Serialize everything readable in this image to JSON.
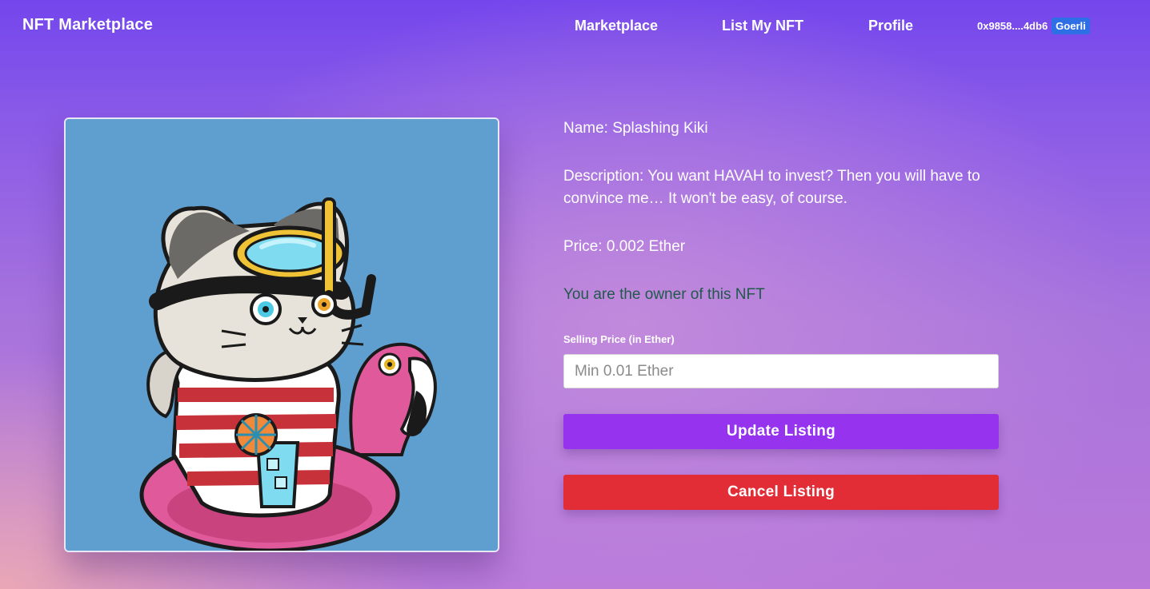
{
  "nav": {
    "brand": "NFT Marketplace",
    "links": [
      "Marketplace",
      "List My NFT",
      "Profile"
    ],
    "wallet_address": "0x9858....4db6",
    "network": "Goerli"
  },
  "nft": {
    "image_icon": "cat-snorkel-flamingo-artwork",
    "name_line": "Name: Splashing Kiki",
    "description_line": "Description: You want HAVAH to invest? Then you will have to convince me… It won't be easy, of course.",
    "price_line": "Price: 0.002 Ether",
    "owner_line": "You are the owner of this NFT"
  },
  "form": {
    "label": "Selling Price (in Ether)",
    "placeholder": "Min 0.01 Ether",
    "value": "",
    "update_label": "Update Listing",
    "cancel_label": "Cancel Listing"
  },
  "colors": {
    "update_button": "#9533ee",
    "cancel_button": "#e32d36",
    "network_badge": "#2f6fe6",
    "owner_text": "#1f5a4a",
    "art_background": "#5f9fcf"
  }
}
